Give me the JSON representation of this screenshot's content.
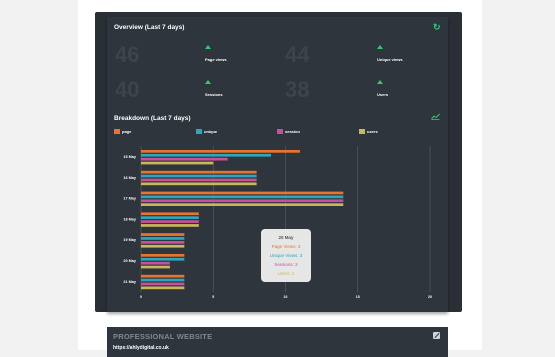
{
  "overview": {
    "title": "Overview (Last 7 days)",
    "stats": [
      {
        "value": "46",
        "label": "Page views"
      },
      {
        "value": "44",
        "label": "Unique views"
      },
      {
        "value": "40",
        "label": "Sessions"
      },
      {
        "value": "38",
        "label": "Users"
      }
    ]
  },
  "breakdown": {
    "title": "Breakdown (Last 7 days)",
    "legend": [
      {
        "label": "page",
        "color": "#e8742f"
      },
      {
        "label": "unique",
        "color": "#2aa8bd"
      },
      {
        "label": "session",
        "color": "#c84f9c"
      },
      {
        "label": "users",
        "color": "#c9b85a"
      }
    ]
  },
  "chart_data": {
    "type": "bar",
    "orientation": "horizontal",
    "categories": [
      "15 May",
      "16 May",
      "17 May",
      "18 May",
      "19 May",
      "20 May",
      "21 May"
    ],
    "series": [
      {
        "name": "page",
        "color": "#e8742f",
        "values": [
          11,
          8,
          14,
          4,
          3,
          3,
          3
        ]
      },
      {
        "name": "unique",
        "color": "#2aa8bd",
        "values": [
          9,
          8,
          14,
          4,
          3,
          3,
          3
        ]
      },
      {
        "name": "session",
        "color": "#c84f9c",
        "values": [
          6,
          8,
          14,
          4,
          3,
          2,
          3
        ]
      },
      {
        "name": "users",
        "color": "#c9b85a",
        "values": [
          5,
          8,
          14,
          4,
          3,
          2,
          3
        ]
      }
    ],
    "xlim": [
      0,
      20
    ],
    "xticks": [
      "0",
      "5",
      "10",
      "15",
      "20"
    ],
    "grid": true,
    "legend_position": "top"
  },
  "tooltip": {
    "date": "20 May",
    "lines": [
      {
        "text": "Page Views: 3",
        "color": "#e8742f"
      },
      {
        "text": "Unique Views: 3",
        "color": "#2aa8bd"
      },
      {
        "text": "Sessions: 2",
        "color": "#c84f9c"
      },
      {
        "text": "Users: 2",
        "color": "#c9b85a"
      }
    ]
  },
  "website": {
    "title": "PROFESSIONAL WEBSITE",
    "url": "https://ahlydigital.co.uk"
  },
  "colors": {
    "panel": "#2f353c",
    "accent": "#2ecc71"
  }
}
